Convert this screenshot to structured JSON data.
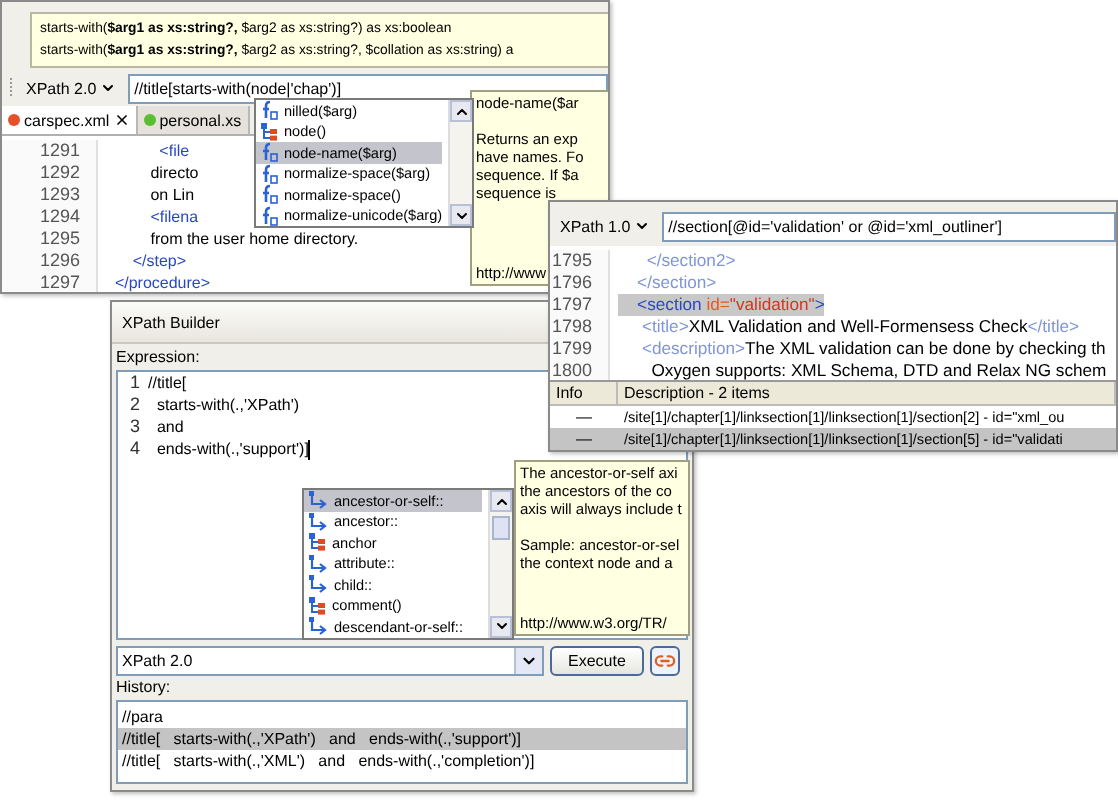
{
  "editor_window": {
    "signature_tooltip": [
      "starts-with(**$arg1 as xs:string?,** $arg2 as xs:string?) as xs:boolean",
      "starts-with(**$arg1 as xs:string?,** $arg2 as xs:string?, $collation as xs:string) a"
    ],
    "xpath_version": "XPath 2.0",
    "query": "//title[starts-with(node|'chap')]",
    "tabs": [
      {
        "label": "carspec.xml",
        "selected": true,
        "color": "#e8502a"
      },
      {
        "label": "personal.xs",
        "selected": false,
        "color": "#58c030"
      }
    ],
    "lines": [
      {
        "number": "1291",
        "segments": [
          {
            "kind": "tag",
            "text": "            <file"
          }
        ]
      },
      {
        "number": "1292",
        "segments": [
          {
            "kind": "text",
            "text": "          directo"
          }
        ]
      },
      {
        "number": "1293",
        "segments": [
          {
            "kind": "text",
            "text": "          on Lin"
          }
        ]
      },
      {
        "number": "1294",
        "segments": [
          {
            "kind": "tag",
            "text": "          <filena"
          }
        ]
      },
      {
        "number": "1295",
        "segments": [
          {
            "kind": "text",
            "text": "          from the user home directory."
          }
        ]
      },
      {
        "number": "1296",
        "segments": [
          {
            "kind": "tag",
            "text": "      </step>"
          }
        ]
      },
      {
        "number": "1297",
        "segments": [
          {
            "kind": "tag",
            "text": "  </procedure>"
          }
        ]
      }
    ],
    "completion": [
      {
        "kind": "function",
        "label": "nilled($arg)",
        "selected": false
      },
      {
        "kind": "node",
        "label": "node()",
        "selected": false
      },
      {
        "kind": "function",
        "label": "node-name($arg)",
        "selected": true
      },
      {
        "kind": "function",
        "label": "normalize-space($arg)",
        "selected": false
      },
      {
        "kind": "function",
        "label": "normalize-space()",
        "selected": false
      },
      {
        "kind": "function",
        "label": "normalize-unicode($arg)",
        "selected": false
      }
    ],
    "doc": [
      [
        "node-name($ar"
      ],
      [
        "Returns an exp",
        "have names. Fo",
        "sequence. If $a",
        "sequence is"
      ],
      [
        "http://www"
      ]
    ]
  },
  "outline_window": {
    "xpath_version": "XPath 1.0",
    "query": "//section[@id='validation' or @id='xml_outliner']",
    "lines": [
      {
        "number": "1795",
        "selected": false,
        "segments": [
          {
            "kind": "tag",
            "text": "      </section2>"
          }
        ]
      },
      {
        "number": "1796",
        "selected": false,
        "segments": [
          {
            "kind": "tag",
            "text": "    </section>"
          }
        ]
      },
      {
        "number": "1797",
        "selected": true,
        "segments": [
          {
            "kind": "tag",
            "text": "    <section "
          },
          {
            "kind": "attr",
            "text": "id="
          },
          {
            "kind": "value",
            "text": "\"validation\""
          },
          {
            "kind": "tag",
            "text": ">"
          }
        ]
      },
      {
        "number": "1798",
        "selected": false,
        "segments": [
          {
            "kind": "tag",
            "text": "     <title>"
          },
          {
            "kind": "text",
            "text": "XML Validation and Well-Formensess Check"
          },
          {
            "kind": "tag",
            "text": "</title>"
          }
        ]
      },
      {
        "number": "1799",
        "selected": false,
        "segments": [
          {
            "kind": "tag",
            "text": "     <description>"
          },
          {
            "kind": "text",
            "text": "The XML validation can be done by checking th"
          }
        ]
      },
      {
        "number": "1800",
        "selected": false,
        "segments": [
          {
            "kind": "text",
            "text": "       Oxygen supports: XML Schema, DTD and Relax NG schem"
          }
        ]
      }
    ],
    "results": {
      "columns": [
        "Info",
        "Description - 2 items"
      ],
      "rows": [
        {
          "info": "—",
          "description": "/site[1]/chapter[1]/linksection[1]/linksection[1]/section[2] - id=\"xml_ou",
          "selected": false
        },
        {
          "info": "—",
          "description": "/site[1]/chapter[1]/linksection[1]/linksection[1]/section[5] - id=\"validati",
          "selected": true
        }
      ]
    }
  },
  "builder_window": {
    "title": "XPath Builder",
    "expression_label": "Expression:",
    "lines": [
      {
        "number": "1",
        "text": "//title["
      },
      {
        "number": "2",
        "text": "  starts-with(.,'XPath')"
      },
      {
        "number": "3",
        "text": "  and"
      },
      {
        "number": "4",
        "text": "  ends-with(.,'support')]"
      }
    ],
    "completion": [
      {
        "kind": "axis",
        "label": "ancestor-or-self::",
        "selected": true
      },
      {
        "kind": "axis",
        "label": "ancestor::",
        "selected": false
      },
      {
        "kind": "node",
        "label": "anchor",
        "selected": false
      },
      {
        "kind": "axis",
        "label": "attribute::",
        "selected": false
      },
      {
        "kind": "axis",
        "label": "child::",
        "selected": false
      },
      {
        "kind": "node",
        "label": "comment()",
        "selected": false
      },
      {
        "kind": "axis",
        "label": "descendant-or-self::",
        "selected": false
      }
    ],
    "doc": [
      [
        "The ancestor-or-self axi",
        "the ancestors of the co",
        "axis will always include t"
      ],
      [
        "Sample: ancestor-or-sel",
        "the context node and a"
      ],
      [
        "http://www.w3.org/TR/"
      ]
    ],
    "xpath_version": "XPath 2.0",
    "execute_label": "Execute",
    "history_label": "History:",
    "history": [
      {
        "text": "//para",
        "selected": false
      },
      {
        "text": "//title[   starts-with(.,'XPath')   and   ends-with(.,'support')]",
        "selected": true
      },
      {
        "text": "//title[   starts-with(.,'XML')   and   ends-with(.,'completion')]",
        "selected": false
      }
    ]
  }
}
